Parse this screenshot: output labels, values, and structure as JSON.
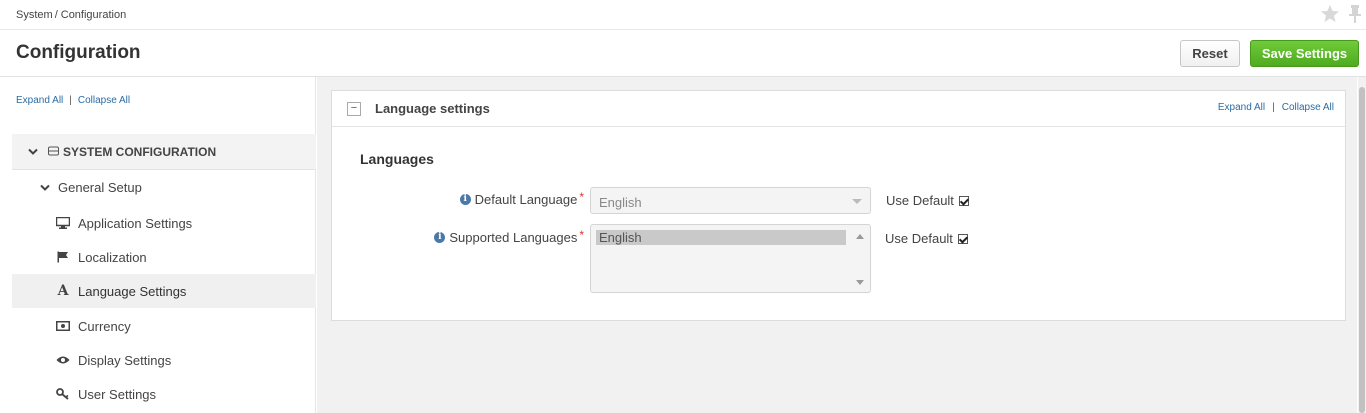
{
  "breadcrumb": {
    "items": [
      "System",
      "Configuration"
    ],
    "separator": "/"
  },
  "header": {
    "title": "Configuration",
    "reset_label": "Reset",
    "save_label": "Save Settings"
  },
  "sidebar": {
    "expand_all": "Expand All",
    "collapse_all": "Collapse All",
    "section_title": "SYSTEM CONFIGURATION",
    "group_title": "General Setup",
    "items": [
      {
        "label": "Application Settings",
        "icon": "monitor-icon"
      },
      {
        "label": "Localization",
        "icon": "flag-icon"
      },
      {
        "label": "Language Settings",
        "icon": "font-icon",
        "active": true
      },
      {
        "label": "Currency",
        "icon": "money-icon"
      },
      {
        "label": "Display Settings",
        "icon": "eye-icon"
      },
      {
        "label": "User Settings",
        "icon": "key-icon"
      }
    ]
  },
  "panel": {
    "title": "Language settings",
    "collapse_symbol": "−",
    "expand_all": "Expand All",
    "collapse_all": "Collapse All",
    "section_title": "Languages",
    "fields": {
      "default_language": {
        "label": "Default Language",
        "value": "English",
        "use_default_label": "Use Default",
        "use_default_checked": true
      },
      "supported_languages": {
        "label": "Supported Languages",
        "options": [
          "English"
        ],
        "use_default_label": "Use Default",
        "use_default_checked": true
      }
    }
  },
  "colors": {
    "accent_green": "#4fab1f",
    "link_blue": "#2b6ca3",
    "required_red": "#d33333",
    "info_blue": "#4a78a8"
  }
}
